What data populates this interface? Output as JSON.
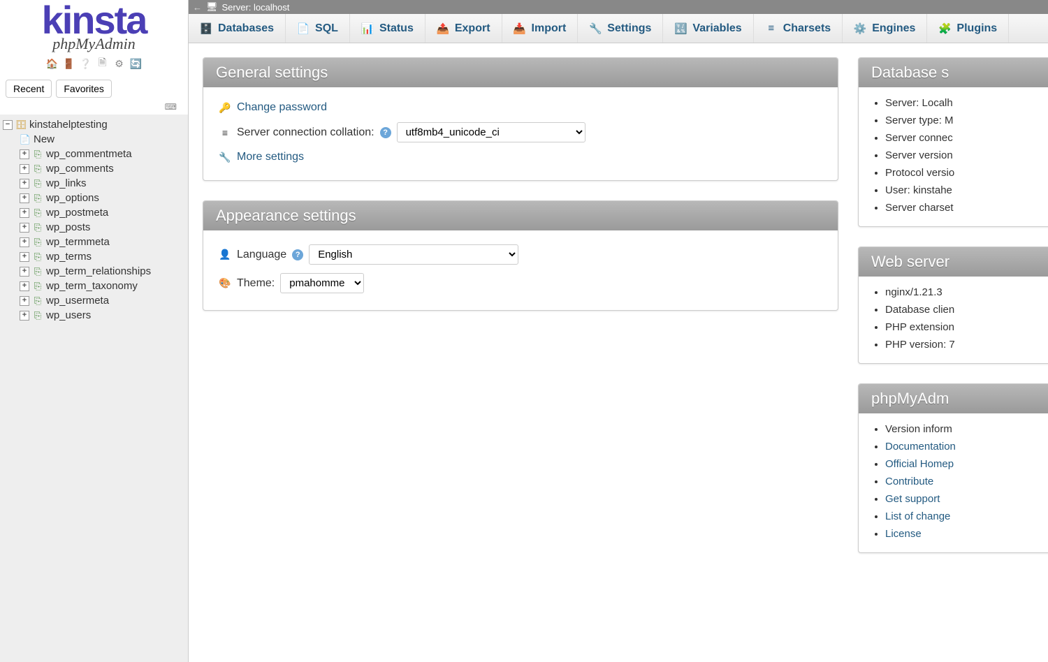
{
  "logo": {
    "brand": "kinsta",
    "product": "phpMyAdmin"
  },
  "sidebar": {
    "tabs": {
      "recent": "Recent",
      "favorites": "Favorites"
    },
    "database": "kinstahelptesting",
    "new_label": "New",
    "tables": [
      "wp_commentmeta",
      "wp_comments",
      "wp_links",
      "wp_options",
      "wp_postmeta",
      "wp_posts",
      "wp_termmeta",
      "wp_terms",
      "wp_term_relationships",
      "wp_term_taxonomy",
      "wp_usermeta",
      "wp_users"
    ]
  },
  "breadcrumb": {
    "server_label": "Server: localhost"
  },
  "topnav": [
    "Databases",
    "SQL",
    "Status",
    "Export",
    "Import",
    "Settings",
    "Variables",
    "Charsets",
    "Engines",
    "Plugins"
  ],
  "topnav_icons": [
    "🗄️",
    "📄",
    "📊",
    "📤",
    "📥",
    "🔧",
    "🔣",
    "≡",
    "⚙️",
    "🧩"
  ],
  "panels": {
    "general": {
      "title": "General settings",
      "change_password": "Change password",
      "collation_label": "Server connection collation:",
      "collation_value": "utf8mb4_unicode_ci",
      "more_settings": "More settings"
    },
    "appearance": {
      "title": "Appearance settings",
      "language_label": "Language",
      "language_value": "English",
      "theme_label": "Theme:",
      "theme_value": "pmahomme"
    },
    "dbserver": {
      "title": "Database s",
      "items": [
        "Server: Localh",
        "Server type: M",
        "Server connec",
        "Server version",
        "Protocol versio",
        "User: kinstahe",
        "Server charset"
      ]
    },
    "webserver": {
      "title": "Web server",
      "items": [
        "nginx/1.21.3",
        "Database clien",
        "PHP extension",
        "PHP version: 7"
      ]
    },
    "pma": {
      "title": "phpMyAdm",
      "items": [
        "Version inform",
        "Documentation",
        "Official Homep",
        "Contribute",
        "Get support",
        "List of change",
        "License"
      ],
      "link_indexes": [
        1,
        2,
        3,
        4,
        5,
        6
      ]
    }
  }
}
